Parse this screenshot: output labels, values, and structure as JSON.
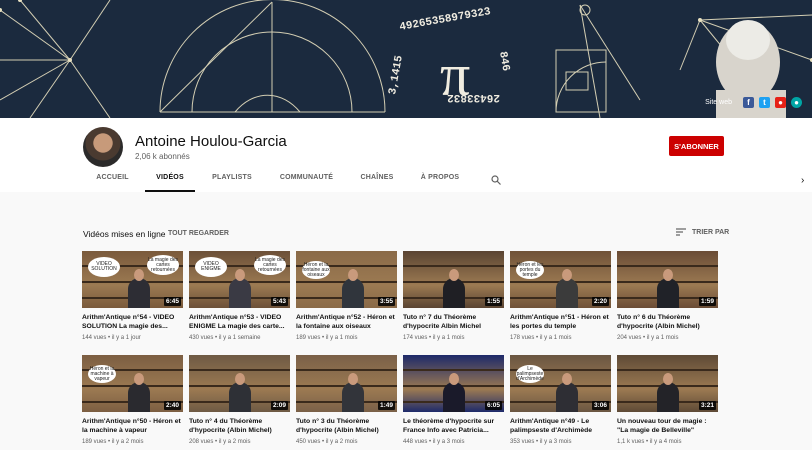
{
  "banner": {
    "pi_digits": "3,14159265358979323846264338327950",
    "social": {
      "site_label": "Site web",
      "colors": [
        "#3b5998",
        "#1da1f2",
        "#e62117",
        "#00a6a6"
      ]
    }
  },
  "channel": {
    "name": "Antoine Houlou-Garcia",
    "subscribers": "2,06 k abonnés",
    "subscribe_label": "S'ABONNER",
    "subscribe_color": "#cc0000"
  },
  "tabs": [
    {
      "label": "ACCUEIL",
      "active": false
    },
    {
      "label": "VIDÉOS",
      "active": true
    },
    {
      "label": "PLAYLISTS",
      "active": false
    },
    {
      "label": "COMMUNAUTÉ",
      "active": false
    },
    {
      "label": "CHAÎNES",
      "active": false
    },
    {
      "label": "À PROPOS",
      "active": false
    }
  ],
  "section": {
    "title": "Vidéos mises en ligne",
    "play_all": "TOUT REGARDER",
    "sort_label": "TRIER PAR"
  },
  "videos": [
    {
      "title": "Arithm'Antique n°54 - VIDEO SOLUTION La magie des...",
      "views": "144 vues",
      "age": "il y a 1 jour",
      "duration": "6:45",
      "bubbles": [
        "VIDEO SOLUTION",
        "La magie des cartes retournées"
      ]
    },
    {
      "title": "Arithm'Antique n°53 - VIDEO ENIGME La magie des carte...",
      "views": "430 vues",
      "age": "il y a 1 semaine",
      "duration": "5:43",
      "bubbles": [
        "VIDEO ENIGME",
        "La magie des cartes retournées"
      ]
    },
    {
      "title": "Arithm'Antique n°52 - Héron et la fontaine aux oiseaux",
      "views": "189 vues",
      "age": "il y a 1 mois",
      "duration": "3:55",
      "bubbles": [
        "Héron et la fontaine aux oiseaux"
      ]
    },
    {
      "title": "Tuto n° 7 du Théorème d'hypocrite Albin Michel",
      "views": "174 vues",
      "age": "il y a 1 mois",
      "duration": "1:55",
      "bubbles": []
    },
    {
      "title": "Arithm'Antique n°51 - Héron et les portes du temple",
      "views": "178 vues",
      "age": "il y a 1 mois",
      "duration": "2:20",
      "bubbles": [
        "Héron et les portes du temple"
      ]
    },
    {
      "title": "Tuto n° 6 du Théorème d'hypocrite (Albin Michel)",
      "views": "204 vues",
      "age": "il y a 1 mois",
      "duration": "1:59",
      "bubbles": []
    },
    {
      "title": "Arithm'Antique n°50 - Héron et la machine à vapeur",
      "views": "189 vues",
      "age": "il y a 2 mois",
      "duration": "2:40",
      "bubbles": [
        "Héron et la machine à vapeur"
      ]
    },
    {
      "title": "Tuto n° 4 du Théorème d'hypocrite (Albin Michel)",
      "views": "208 vues",
      "age": "il y a 2 mois",
      "duration": "2:09",
      "bubbles": []
    },
    {
      "title": "Tuto n° 3 du Théorème d'hypocrite (Albin Michel)",
      "views": "450 vues",
      "age": "il y a 2 mois",
      "duration": "1:49",
      "bubbles": []
    },
    {
      "title": "Le théorème d'hypocrite sur France Info avec Patricia...",
      "views": "448 vues",
      "age": "il y a 3 mois",
      "duration": "6:05",
      "bubbles": []
    },
    {
      "title": "Arithm'Antique n°49 - Le palimpseste d'Archimède",
      "views": "353 vues",
      "age": "il y a 3 mois",
      "duration": "3:06",
      "bubbles": [
        "Le palimpseste d'Archimède"
      ]
    },
    {
      "title": "Un nouveau tour de magie : \"La magie de Belleville\"",
      "views": "1,1 k vues",
      "age": "il y a 4 mois",
      "duration": "3:21",
      "bubbles": []
    }
  ]
}
